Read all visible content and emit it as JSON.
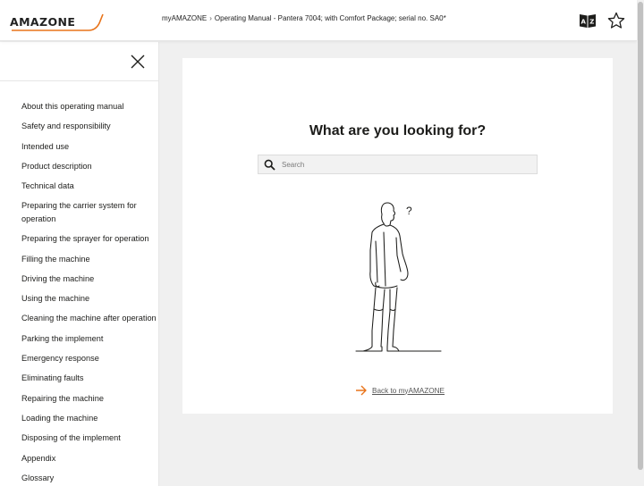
{
  "header": {
    "logo_text": "AMAZONE",
    "breadcrumb": {
      "root": "myAMAZONE",
      "separator": "›",
      "current": "Operating Manual - Pantera 7004; with Comfort Package; serial no. SA0*"
    },
    "icons": {
      "dictionary": "dictionary-icon",
      "favorite": "star-icon"
    }
  },
  "sidebar": {
    "items": [
      "About this operating manual",
      "Safety and responsibility",
      "Intended use",
      "Product description",
      "Technical data",
      "Preparing the carrier system for operation",
      "Preparing the sprayer for operation",
      "Filling the machine",
      "Driving the machine",
      "Using the machine",
      "Cleaning the machine after operation",
      "Parking the implement",
      "Emergency response",
      "Eliminating faults",
      "Repairing the machine",
      "Loading the machine",
      "Disposing of the implement",
      "Appendix",
      "Glossary"
    ]
  },
  "main": {
    "headline": "What are you looking for?",
    "search_placeholder": "Search",
    "back_link": "Back to myAMAZONE",
    "illustration_mark": "?"
  },
  "colors": {
    "accent": "#e8731a",
    "text": "#1d1d1b",
    "background": "#f0f0f0"
  }
}
